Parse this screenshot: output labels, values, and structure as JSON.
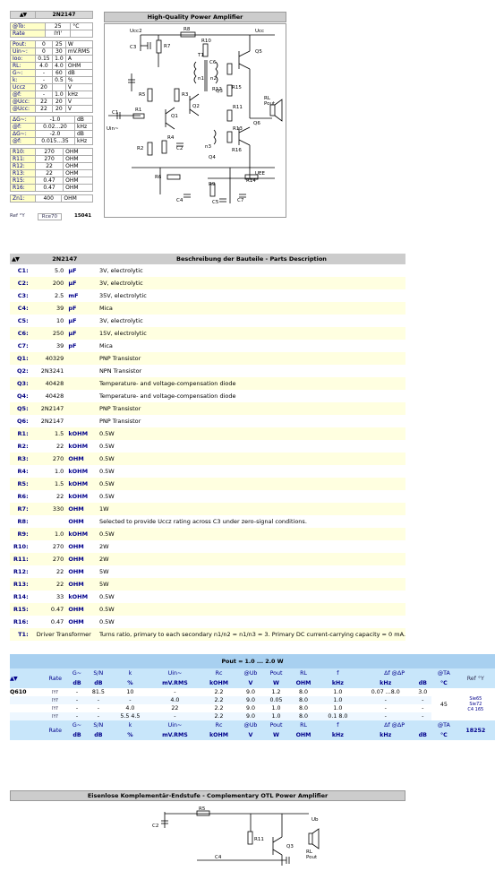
{
  "spec": {
    "model": "2N2147",
    "rows_top": [
      {
        "label": "@To:",
        "v1": "25",
        "v2": "",
        "unit": "°C"
      },
      {
        "label": "Rate",
        "v1": "IYI'",
        "v2": "",
        "unit": ""
      }
    ],
    "rows_main": [
      {
        "label": "Pout:",
        "v1": "0",
        "v2": "25",
        "unit": "W"
      },
      {
        "label": "Uin~:",
        "v1": "0",
        "v2": "30",
        "unit": "mV.RMS"
      },
      {
        "label": "Ioo:",
        "v1": "0.15",
        "v2": "1.0",
        "unit": "A"
      },
      {
        "label": "RL:",
        "v1": "4.0",
        "v2": "4.0",
        "unit": "OHM"
      },
      {
        "label": "G~:",
        "v1": "-",
        "v2": "60",
        "unit": "dB"
      },
      {
        "label": "k:",
        "v1": "-",
        "v2": "0.5",
        "unit": "%"
      },
      {
        "label": "Uccz",
        "v1": "20",
        "v2": "",
        "unit": "V"
      },
      {
        "label": "@f:",
        "v1": "-",
        "v2": "1.0",
        "unit": "kHz"
      },
      {
        "label": "@Ucc:",
        "v1": "22",
        "v2": "20",
        "unit": "V"
      },
      {
        "label": "@Ucc:",
        "v1": "22",
        "v2": "20",
        "unit": "V"
      }
    ],
    "rows_g": [
      {
        "label": "ΔG~:",
        "v": "-1.0",
        "unit": "dB"
      },
      {
        "label": "@f:",
        "v": "0.02...20",
        "unit": "kHz"
      },
      {
        "label": "ΔG~:",
        "v": "-2.0",
        "unit": "dB"
      },
      {
        "label": "@f:",
        "v": "0.015...35",
        "unit": "kHz"
      }
    ],
    "rows_r": [
      {
        "label": "R10:",
        "v": "270",
        "unit": "OHM"
      },
      {
        "label": "R11:",
        "v": "270",
        "unit": "OHM"
      },
      {
        "label": "R12:",
        "v": "22",
        "unit": "OHM"
      },
      {
        "label": "R13:",
        "v": "22",
        "unit": "OHM"
      },
      {
        "label": "R15:",
        "v": "0.47",
        "unit": "OHM"
      },
      {
        "label": "R16:",
        "v": "0.47",
        "unit": "OHM"
      }
    ],
    "zin": {
      "label": "Zn1:",
      "v": "400",
      "unit": "OHM"
    },
    "footer": {
      "ref": "Ref °Y",
      "rate": "Rce70",
      "code": "15041"
    }
  },
  "schematic": {
    "title": "High-Quality Power Amplifier",
    "labels": [
      "Ucc2",
      "R8",
      "C3",
      "R7",
      "R10",
      "T1",
      "Ucc",
      "Q5",
      "C6",
      "R12",
      "n2",
      "n1",
      "R5",
      "R3",
      "R15",
      "Q3",
      "RL",
      "Pout",
      "C1",
      "R1",
      "Q1",
      "Q2",
      "R11",
      "Q6",
      "Uin~",
      "R4",
      "C2",
      "R2",
      "R13",
      "n3",
      "R16",
      "Q4",
      "UEE",
      "R6",
      "R9",
      "R14",
      "C4",
      "C5",
      "C7"
    ]
  },
  "parts": {
    "model": "2N2147",
    "title": "Beschreibung der Bauteile - Parts Description",
    "rows": [
      {
        "name": "C1:",
        "value": "5.0",
        "unit": "µF",
        "desc": "3V, electrolytic"
      },
      {
        "name": "C2:",
        "value": "200",
        "unit": "µF",
        "desc": "3V, electrolytic"
      },
      {
        "name": "C3:",
        "value": "2.5",
        "unit": "mF",
        "desc": "35V, electrolytic"
      },
      {
        "name": "C4:",
        "value": "39",
        "unit": "pF",
        "desc": "Mica"
      },
      {
        "name": "C5:",
        "value": "10",
        "unit": "µF",
        "desc": "3V, electrolytic"
      },
      {
        "name": "C6:",
        "value": "250",
        "unit": "µF",
        "desc": "15V, electrolytic"
      },
      {
        "name": "C7:",
        "value": "39",
        "unit": "pF",
        "desc": "Mica"
      },
      {
        "name": "Q1:",
        "value": "40329",
        "unit": "",
        "desc": "PNP Transistor"
      },
      {
        "name": "Q2:",
        "value": "2N3241",
        "unit": "",
        "desc": "NPN Transistor"
      },
      {
        "name": "Q3:",
        "value": "40428",
        "unit": "",
        "desc": "Temperature- and voltage-compensation diode"
      },
      {
        "name": "Q4:",
        "value": "40428",
        "unit": "",
        "desc": "Temperature- and voltage-compensation diode"
      },
      {
        "name": "Q5:",
        "value": "2N2147",
        "unit": "",
        "desc": "PNP Transistor"
      },
      {
        "name": "Q6:",
        "value": "2N2147",
        "unit": "",
        "desc": "PNP Transistor"
      },
      {
        "name": "R1:",
        "value": "1.5",
        "unit": "kOHM",
        "desc": "0.5W"
      },
      {
        "name": "R2:",
        "value": "22",
        "unit": "kOHM",
        "desc": "0.5W"
      },
      {
        "name": "R3:",
        "value": "270",
        "unit": "OHM",
        "desc": "0.5W"
      },
      {
        "name": "R4:",
        "value": "1.0",
        "unit": "kOHM",
        "desc": "0.5W"
      },
      {
        "name": "R5:",
        "value": "1.5",
        "unit": "kOHM",
        "desc": "0.5W"
      },
      {
        "name": "R6:",
        "value": "22",
        "unit": "kOHM",
        "desc": "0.5W"
      },
      {
        "name": "R7:",
        "value": "330",
        "unit": "OHM",
        "desc": "1W"
      },
      {
        "name": "R8:",
        "value": "",
        "unit": "OHM",
        "desc": "Selected to provide Uccz rating across C3 under zero-signal conditions."
      },
      {
        "name": "R9:",
        "value": "1.0",
        "unit": "kOHM",
        "desc": "0.5W"
      },
      {
        "name": "R10:",
        "value": "270",
        "unit": "OHM",
        "desc": "2W"
      },
      {
        "name": "R11:",
        "value": "270",
        "unit": "OHM",
        "desc": "2W"
      },
      {
        "name": "R12:",
        "value": "22",
        "unit": "OHM",
        "desc": "5W"
      },
      {
        "name": "R13:",
        "value": "22",
        "unit": "OHM",
        "desc": "5W"
      },
      {
        "name": "R14:",
        "value": "33",
        "unit": "kOHM",
        "desc": "0.5W"
      },
      {
        "name": "R15:",
        "value": "0.47",
        "unit": "OHM",
        "desc": "0.5W"
      },
      {
        "name": "R16:",
        "value": "0.47",
        "unit": "OHM",
        "desc": "0.5W"
      },
      {
        "name": "T1:",
        "value": "Driver Transformer",
        "unit": "",
        "desc": "Turns ratio, primary to each secondary n1/n2 = n1/n3 = 3. Primary DC current-carrying capacity = 0 mA."
      }
    ]
  },
  "perf": {
    "title": "Pout = 1.0 ... 2.0 W",
    "model": "Q610",
    "rate": "Rate",
    "ref": "Ref °Y",
    "symbols": [
      "G~",
      "S/N",
      "k",
      "Uin~",
      "Rc",
      "@Ub",
      "Pout",
      "RL",
      "f",
      "Δf @ΔP",
      "",
      "@TA"
    ],
    "units": [
      "dB",
      "dB",
      "%",
      "mV.RMS",
      "kOHM",
      "V",
      "W",
      "OHM",
      "kHz",
      "kHz",
      "dB",
      "°C"
    ],
    "rows": [
      {
        "rate": "IYI'",
        "c": [
          "-",
          "81.5",
          "10",
          "-",
          "2.2",
          "9.0",
          "1.2",
          "8.0",
          "1.0",
          "0.07 ...8.0",
          "3.0"
        ]
      },
      {
        "rate": "IYI'",
        "c": [
          "-",
          "-",
          "-",
          "4.0",
          "2.2",
          "9.0",
          "0.05",
          "8.0",
          "1.0",
          "-",
          "-"
        ]
      },
      {
        "rate": "IYI'",
        "c": [
          "-",
          "-",
          "4.0",
          "22",
          "2.2",
          "9.0",
          "1.0",
          "8.0",
          "1.0",
          "-",
          "-"
        ]
      },
      {
        "rate": "IYI'",
        "c": [
          "-",
          "-",
          "5.5 4.5",
          "-",
          "2.2",
          "9.0",
          "1.0",
          "8.0",
          "0.1 8.0",
          "-",
          "-"
        ]
      }
    ],
    "ta": "45",
    "notes": [
      "Sie65",
      "Sie72",
      "C4 165"
    ],
    "code": "18252",
    "subtitle": "Eisenlose Komplementär-Endstufe - Complementary OTL Power Amplifier"
  },
  "bottom_schematic": {
    "labels": [
      "C2",
      "R5",
      "Ub",
      "R11",
      "Q3",
      "RL",
      "Pout",
      "C4"
    ]
  }
}
